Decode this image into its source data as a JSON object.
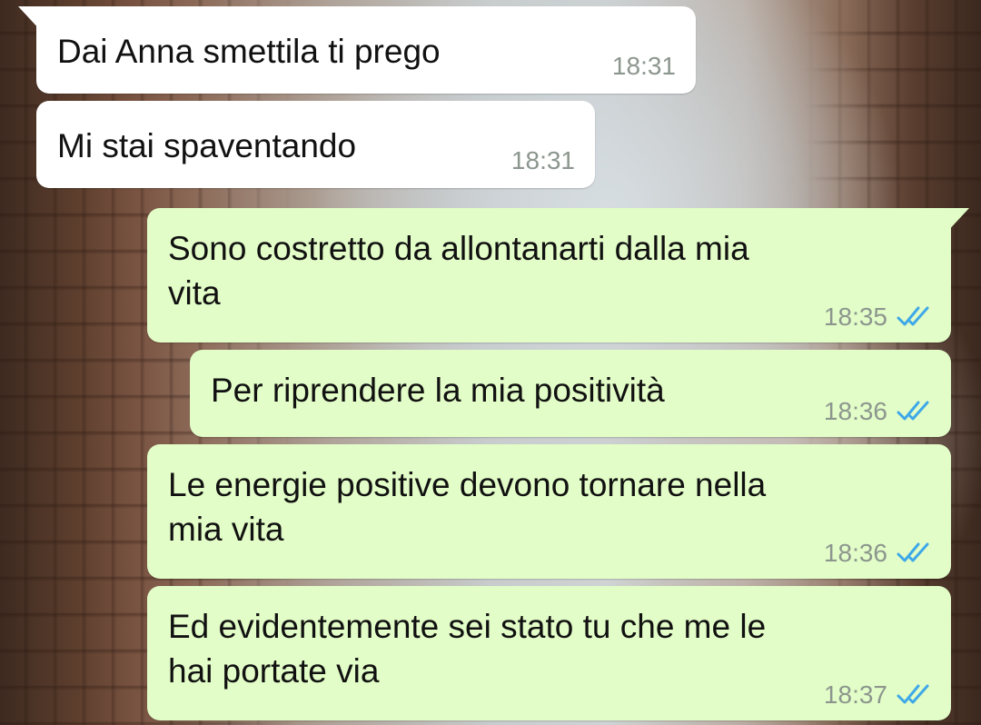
{
  "conversation": {
    "messages": [
      {
        "direction": "incoming",
        "text": "Dai Anna smettila ti prego",
        "time": "18:31"
      },
      {
        "direction": "incoming",
        "text": "Mi stai spaventando",
        "time": "18:31"
      },
      {
        "direction": "outgoing",
        "text": "Sono costretto da allontanarti dalla mia\nvita",
        "time": "18:35",
        "status": "read"
      },
      {
        "direction": "outgoing",
        "text": "Per riprendere la mia positività",
        "time": "18:36",
        "status": "read"
      },
      {
        "direction": "outgoing",
        "text": "Le energie positive devono tornare nella\nmia vita",
        "time": "18:36",
        "status": "read"
      },
      {
        "direction": "outgoing",
        "text": "Ed evidentemente sei stato tu che me le\nhai portate via",
        "time": "18:37",
        "status": "read"
      }
    ]
  },
  "colors": {
    "incoming_bubble": "#ffffff",
    "outgoing_bubble": "#e2fdc7",
    "time_text": "#8c968e",
    "read_check": "#3fa8e8"
  },
  "icons": {
    "read_receipt": "double-check-icon"
  }
}
